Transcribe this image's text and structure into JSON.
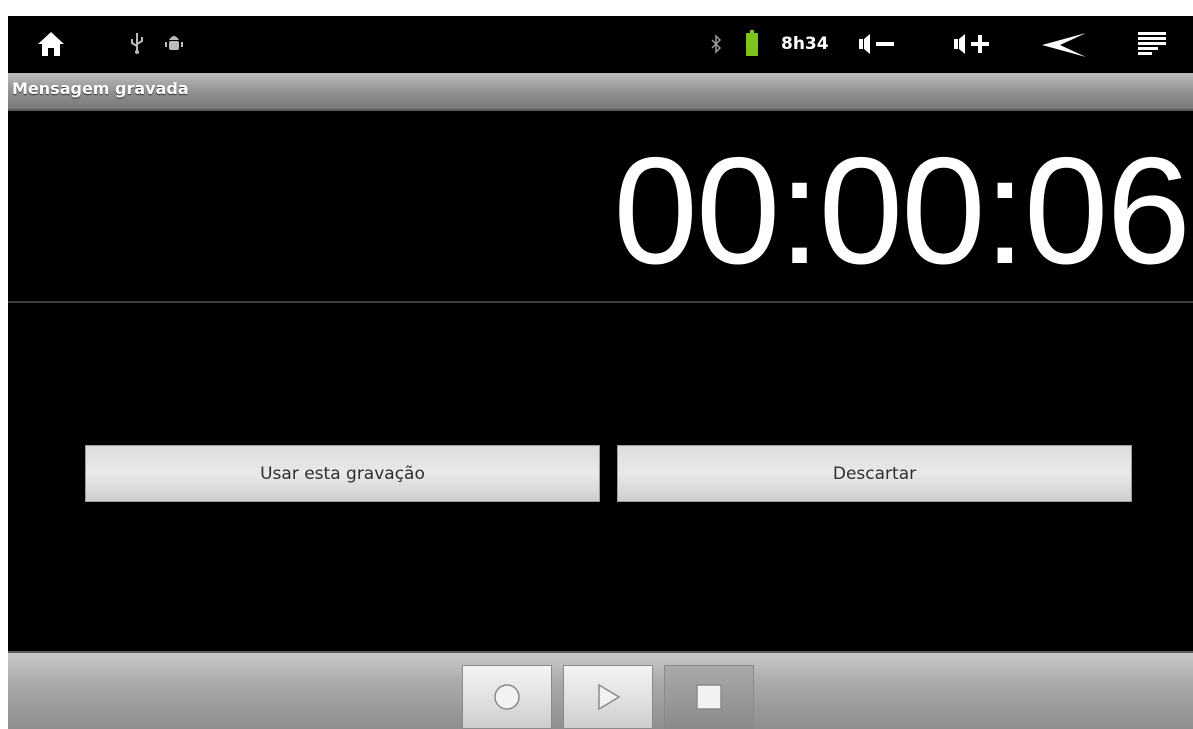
{
  "status_bar": {
    "time": "8h34",
    "icons": [
      "home-icon",
      "usb-icon",
      "android-debug-icon",
      "bluetooth-icon",
      "battery-icon",
      "volume-down-icon",
      "volume-up-icon",
      "back-icon",
      "menu-icon"
    ],
    "colors": {
      "battery": "#7dc41f"
    }
  },
  "title_bar": {
    "title": "Mensagem gravada"
  },
  "recorder": {
    "elapsed_time": "00:00:06"
  },
  "actions": {
    "use_label": "Usar esta gravação",
    "discard_label": "Descartar"
  },
  "controls": {
    "icons": [
      "record-icon",
      "play-icon",
      "stop-icon"
    ]
  }
}
